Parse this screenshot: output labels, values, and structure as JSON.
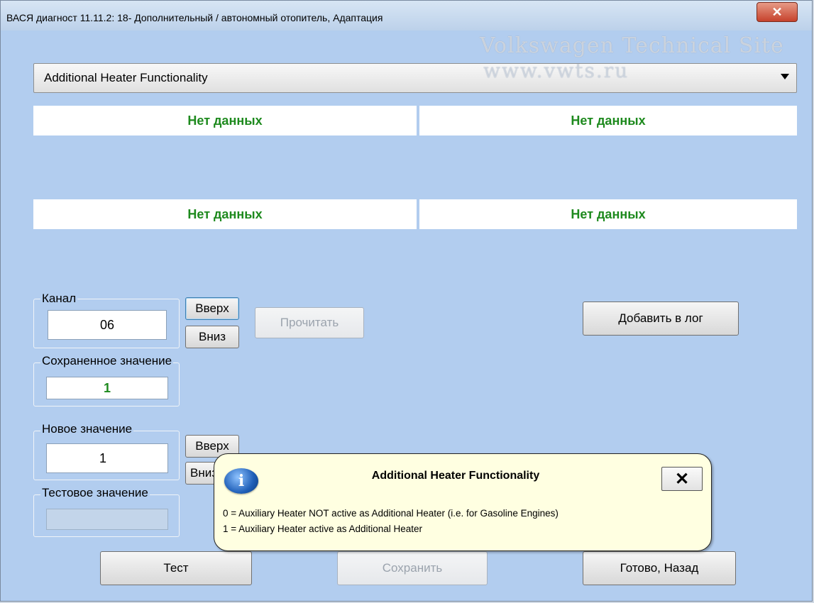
{
  "window": {
    "title": "ВАСЯ диагност 11.11.2: 18- Дополнительный / автономный отопитель, Адаптация",
    "close_symbol": "✕"
  },
  "watermark": {
    "line1": "Volkswagen Technical Site",
    "line2": "www.vwts.ru"
  },
  "dropdown": {
    "selected": "Additional Heater Functionality"
  },
  "data_fields": [
    "Нет данных",
    "Нет данных",
    "Нет данных",
    "Нет данных"
  ],
  "channel": {
    "label": "Канал",
    "value": "06",
    "up_label": "Вверх",
    "down_label": "Вниз",
    "read_label": "Прочитать"
  },
  "add_log_label": "Добавить в лог",
  "saved": {
    "label": "Сохраненное значение",
    "value": "1"
  },
  "new_value": {
    "label": "Новое значение",
    "value": "1",
    "up_label": "Вверх",
    "down_label": "Вниз"
  },
  "test_value": {
    "label": "Тестовое значение",
    "value": ""
  },
  "buttons": {
    "test": "Тест",
    "save": "Сохранить",
    "done_back": "Готово, Назад"
  },
  "tooltip": {
    "title": "Additional Heater Functionality",
    "icon": "info-icon",
    "close_symbol": "✕",
    "lines": [
      "0 = Auxiliary Heater NOT active as Additional Heater (i.e. for Gasoline Engines)",
      "1 = Auxiliary Heater active as Additional Heater"
    ]
  },
  "colors": {
    "panel_bg": "#b2cdef",
    "status_text": "#1e8a1e",
    "tooltip_bg": "#ffffe1",
    "close_button": "#c6422c"
  }
}
